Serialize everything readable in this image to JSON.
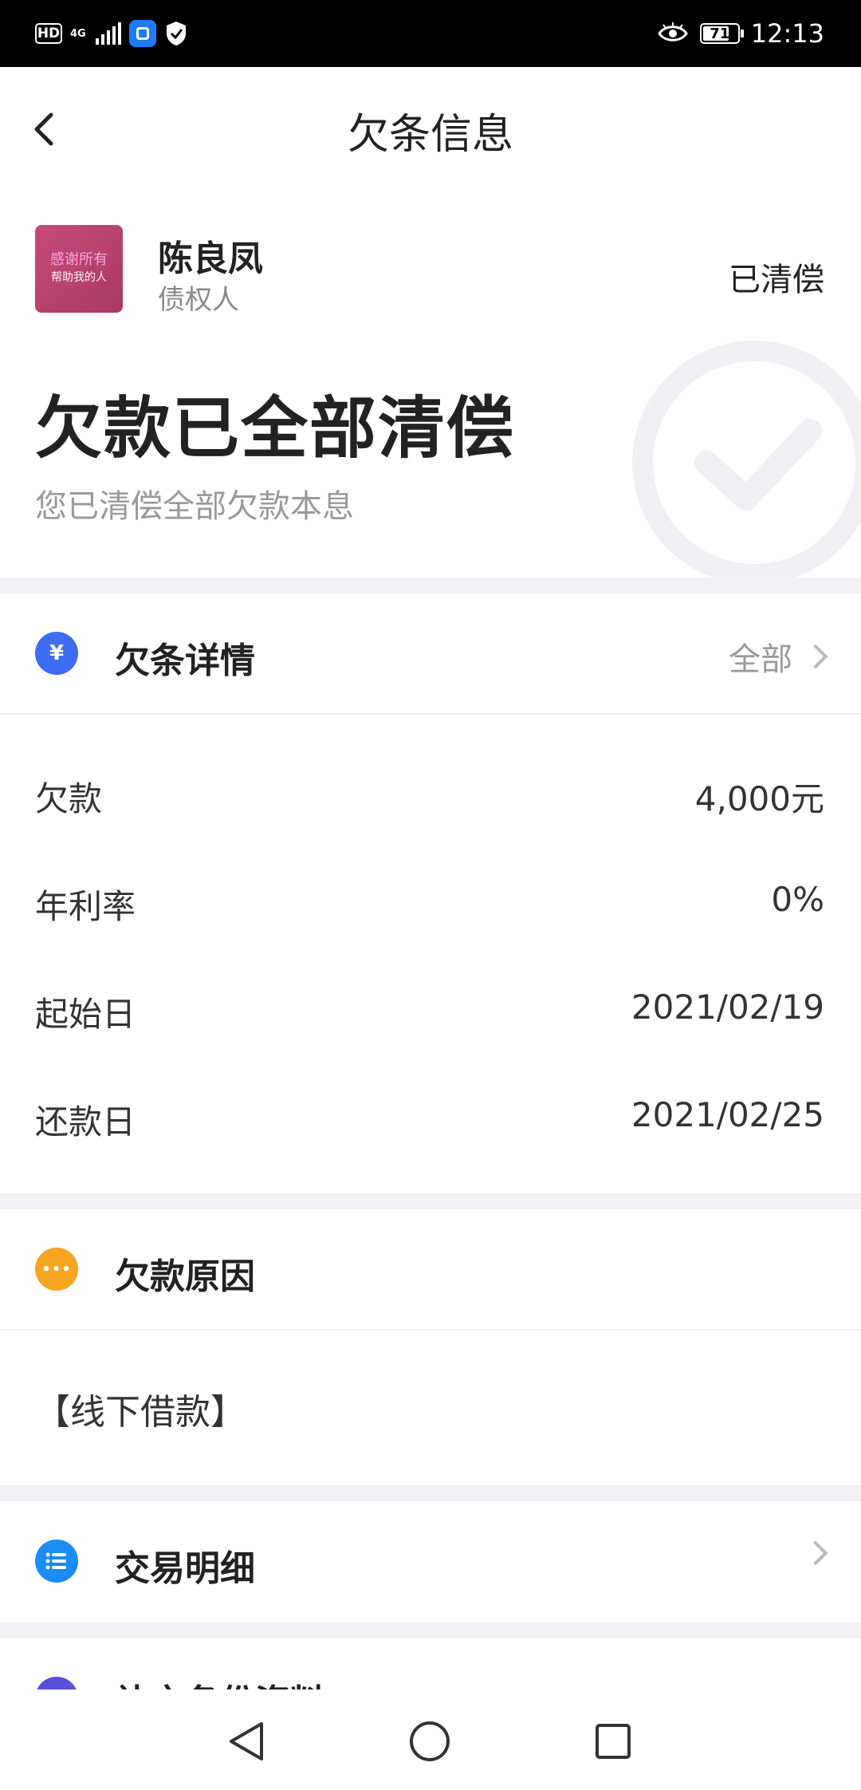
{
  "status_bar": {
    "hd": "HD",
    "network": "4G",
    "battery": "71",
    "time": "12:13"
  },
  "header": {
    "title": "欠条信息"
  },
  "creditor": {
    "avatar_line1": "感谢所有",
    "avatar_line2": "帮助我的人",
    "name": "陈良凤",
    "role": "债权人",
    "status": "已清偿"
  },
  "banner": {
    "title": "欠款已全部清偿",
    "subtitle": "您已清偿全部欠款本息"
  },
  "details": {
    "title": "欠条详情",
    "icon_symbol": "¥",
    "all_label": "全部",
    "rows": [
      {
        "label": "欠款",
        "value": "4,000元"
      },
      {
        "label": "年利率",
        "value": "0%"
      },
      {
        "label": "起始日",
        "value": "2021/02/19"
      },
      {
        "label": "还款日",
        "value": "2021/02/25"
      }
    ]
  },
  "reason": {
    "title": "欠款原因",
    "icon_symbol": "•••",
    "text": "【线下借款】"
  },
  "transactions": {
    "title": "交易明细"
  },
  "partial_section": {
    "title": "补充备份资料"
  },
  "colors": {
    "details_icon": "#3d6cf0",
    "reason_icon": "#f6a623",
    "transactions_icon": "#1a8cf2",
    "partial_icon": "#5a4fd6",
    "divider": "#f0f1f4"
  }
}
